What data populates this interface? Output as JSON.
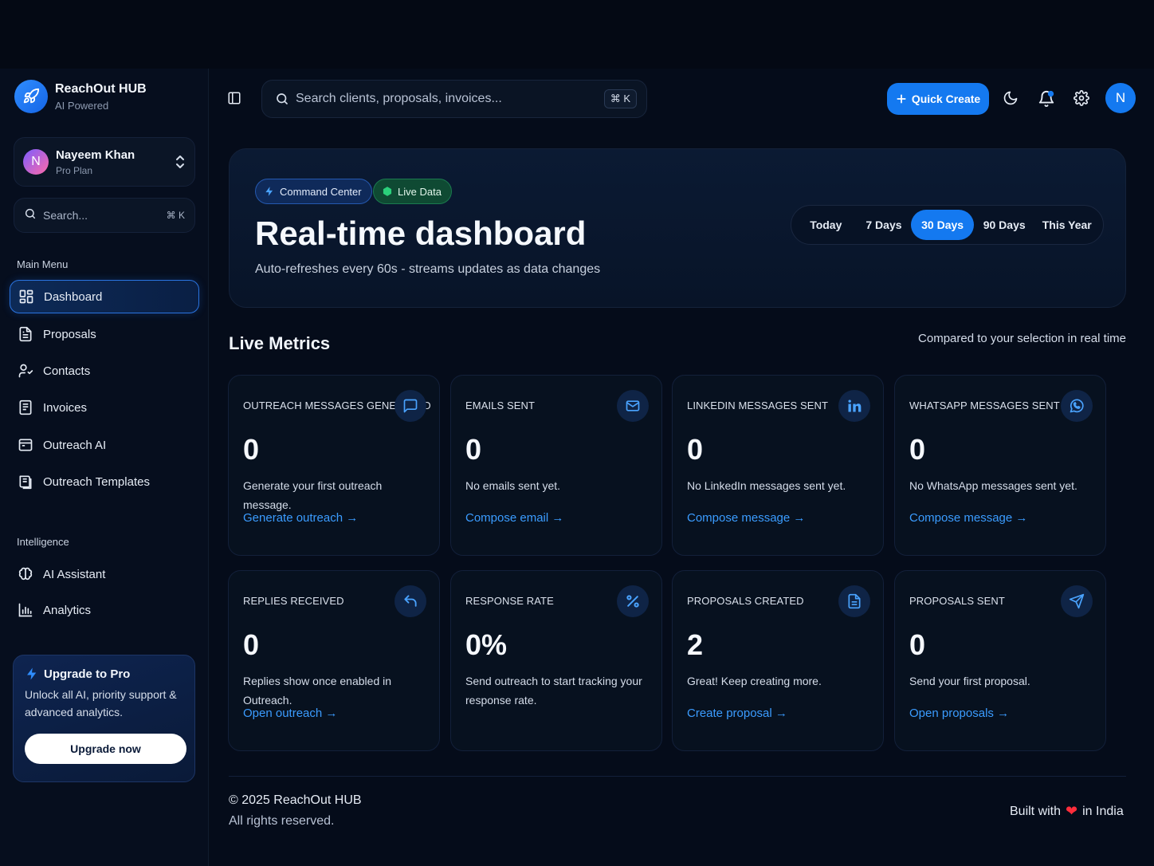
{
  "brand": {
    "name": "ReachOut HUB",
    "tagline": "AI Powered"
  },
  "user": {
    "initial": "N",
    "name": "Nayeem Khan",
    "plan": "Pro Plan"
  },
  "sidebar": {
    "search_label": "Search...",
    "search_shortcut": "⌘ K",
    "main_menu_label": "Main Menu",
    "main_items": [
      {
        "label": "Dashboard",
        "icon": "dashboard-icon",
        "active": true
      },
      {
        "label": "Proposals",
        "icon": "document-icon"
      },
      {
        "label": "Contacts",
        "icon": "contacts-icon"
      },
      {
        "label": "Invoices",
        "icon": "invoice-icon"
      },
      {
        "label": "Outreach AI",
        "icon": "mail-icon"
      },
      {
        "label": "Outreach Templates",
        "icon": "templates-icon"
      }
    ],
    "intelligence_label": "Intelligence",
    "intelligence_items": [
      {
        "label": "AI Assistant",
        "icon": "brain-icon"
      },
      {
        "label": "Analytics",
        "icon": "analytics-icon"
      }
    ],
    "upgrade": {
      "title": "Upgrade to Pro",
      "description": "Unlock all AI, priority support & advanced analytics.",
      "button": "Upgrade now"
    }
  },
  "topbar": {
    "search_placeholder": "Search clients, proposals, invoices...",
    "search_shortcut": "⌘ K",
    "quick_create": "Quick Create",
    "avatar_initial": "N"
  },
  "hero": {
    "badge_command": "Command Center",
    "badge_live": "Live Data",
    "title": "Real-time dashboard",
    "subtitle": "Auto-refreshes every 60s - streams updates as data changes",
    "ranges": [
      "Today",
      "7 Days",
      "30 Days",
      "90 Days",
      "This Year"
    ],
    "selected_range": "30 Days"
  },
  "metrics": {
    "title": "Live Metrics",
    "note": "Compared to your selection in real time",
    "cards": [
      {
        "label": "OUTREACH MESSAGES GENERATED",
        "value": "0",
        "description": "Generate your first outreach message.",
        "link": "Generate outreach →",
        "icon": "chat-icon"
      },
      {
        "label": "EMAILS SENT",
        "value": "0",
        "description": "No emails sent yet.",
        "link": "Compose email →",
        "icon": "mail-icon"
      },
      {
        "label": "LINKEDIN MESSAGES SENT",
        "value": "0",
        "description": "No LinkedIn messages sent yet.",
        "link": "Compose message →",
        "icon": "linkedin-icon"
      },
      {
        "label": "WHATSAPP MESSAGES SENT",
        "value": "0",
        "description": "No WhatsApp messages sent yet.",
        "link": "Compose message →",
        "icon": "whatsapp-icon"
      },
      {
        "label": "REPLIES RECEIVED",
        "value": "0",
        "description": "Replies show once enabled in Outreach.",
        "link": "Open outreach →",
        "icon": "reply-icon"
      },
      {
        "label": "RESPONSE RATE",
        "value": "0%",
        "description": "Send outreach to start tracking your response rate.",
        "link": "",
        "icon": "percent-icon"
      },
      {
        "label": "PROPOSALS CREATED",
        "value": "2",
        "description": "Great! Keep creating more.",
        "link": "Create proposal →",
        "icon": "document-icon"
      },
      {
        "label": "PROPOSALS SENT",
        "value": "0",
        "description": "Send your first proposal.",
        "link": "Open proposals →",
        "icon": "send-icon"
      }
    ]
  },
  "footer": {
    "copyright": "© 2025 ReachOut HUB",
    "rights": "All rights reserved.",
    "built_prefix": "Built with",
    "built_suffix": "in India"
  },
  "colors": {
    "accent": "#1479f0",
    "link": "#3b9cff",
    "live": "#1b7a4f",
    "heart": "#ff2d3b"
  }
}
